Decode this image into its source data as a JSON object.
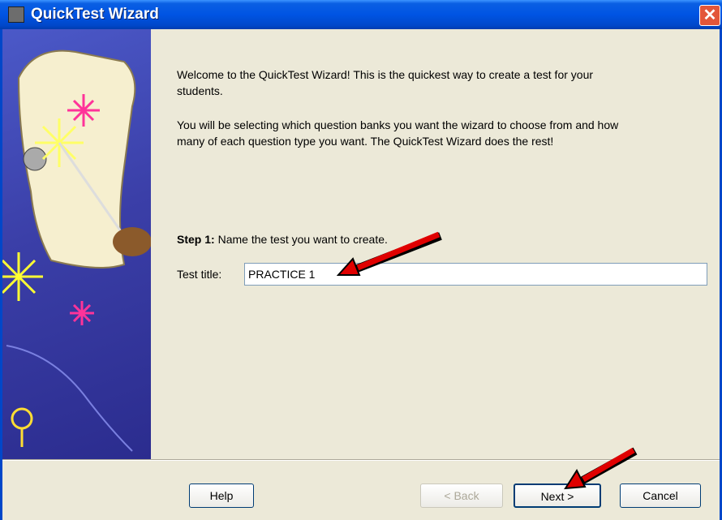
{
  "window": {
    "title": "QuickTest Wizard",
    "close_glyph": "✕"
  },
  "intro": {
    "paragraph1": "Welcome to the QuickTest Wizard!  This is the quickest way to create a test for your students.",
    "paragraph2": "You will be selecting which question banks you want the wizard to choose from and how many of each question type you want.  The QuickTest Wizard does the rest!"
  },
  "step": {
    "number_label": "Step 1:",
    "instruction": "Name the test you want to create."
  },
  "test_title": {
    "label": "Test title:",
    "value": "PRACTICE 1"
  },
  "buttons": {
    "help": "Help",
    "back": "< Back",
    "next": "Next >",
    "cancel": "Cancel"
  },
  "colors": {
    "titlebar": "#0054E3",
    "sidebar": "#3b3fa8",
    "dialog": "#ECE9D8",
    "annotation_arrow": "#E00000"
  }
}
